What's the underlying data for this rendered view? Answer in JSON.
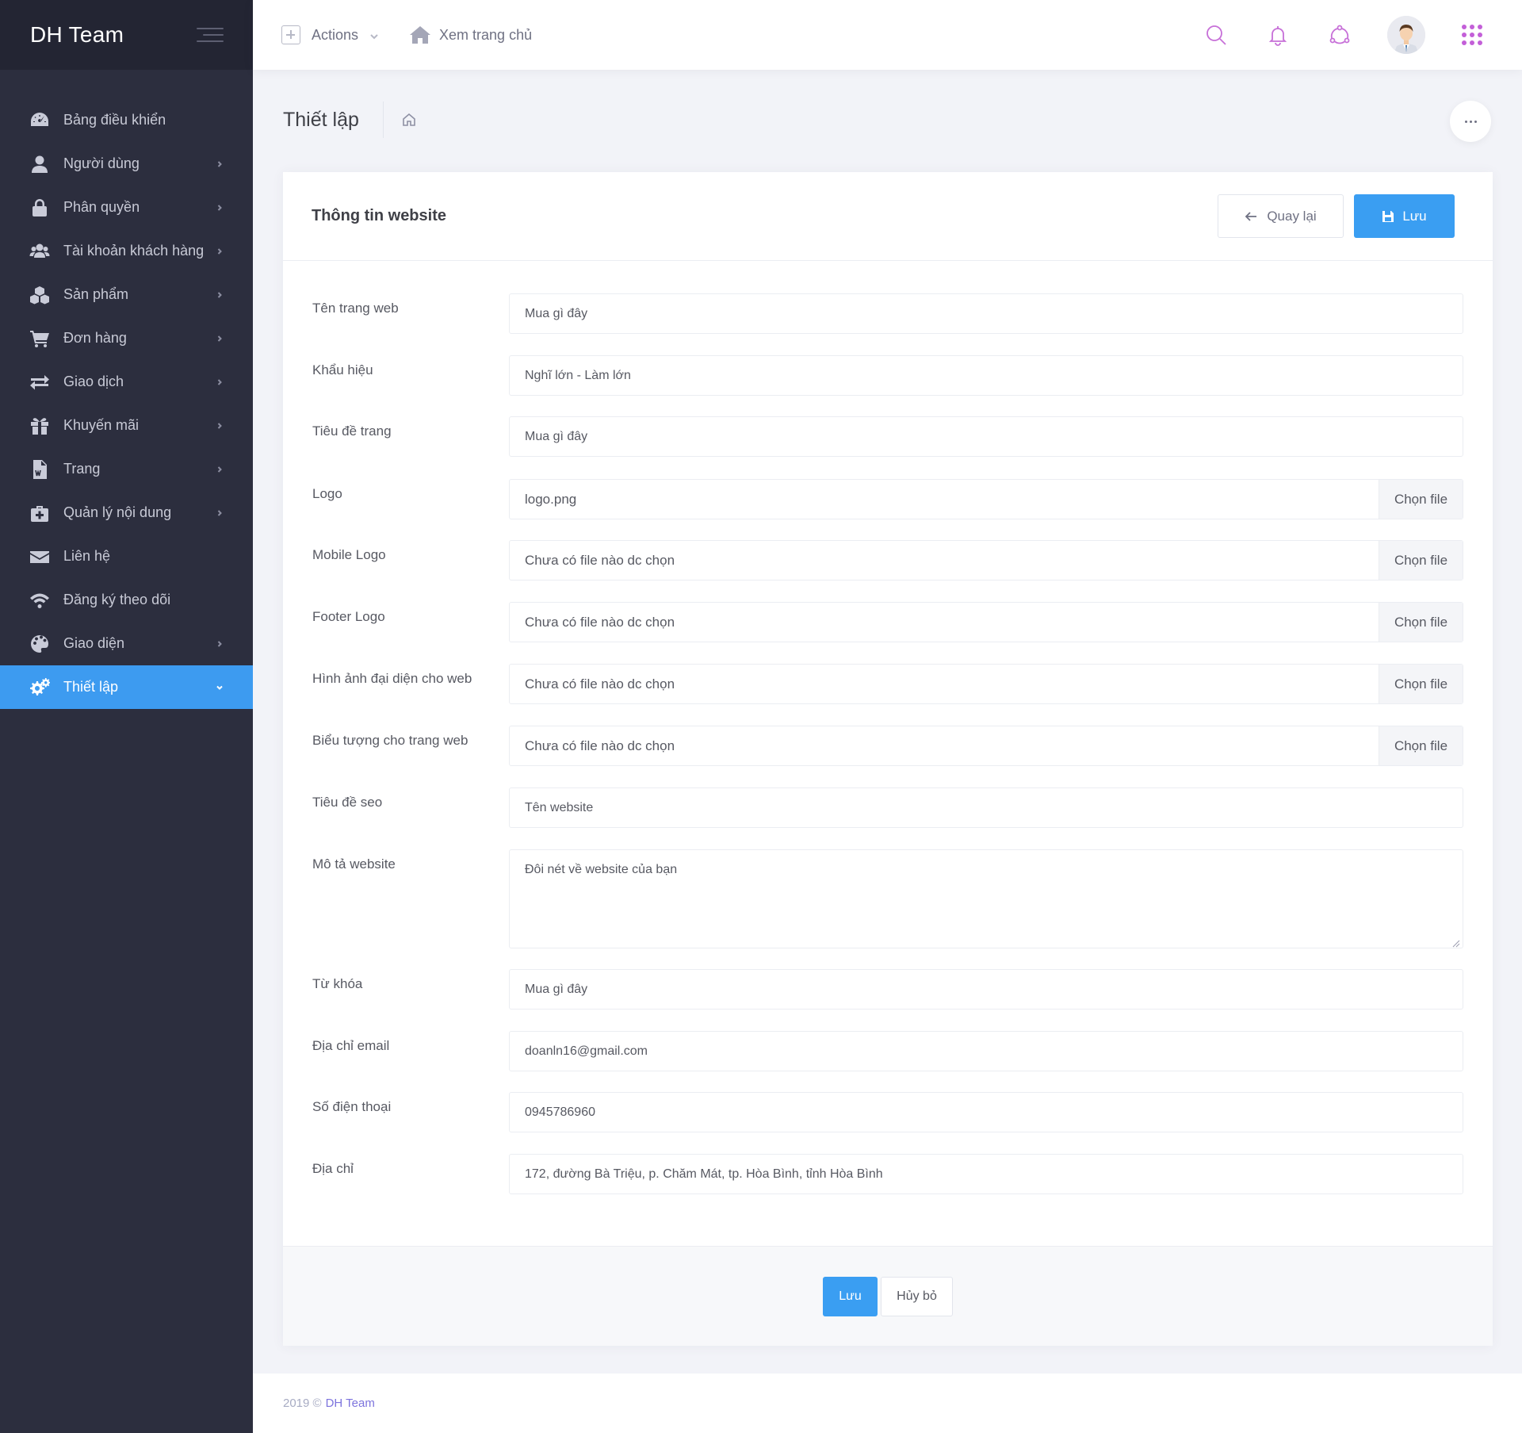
{
  "brand": {
    "name": "DH Team"
  },
  "sidebar": {
    "items": [
      {
        "label": "Bảng điều khiển",
        "icon": "dashboard-icon",
        "has_arrow": false,
        "active": false
      },
      {
        "label": "Người dùng",
        "icon": "user-icon",
        "has_arrow": true,
        "active": false
      },
      {
        "label": "Phân quyền",
        "icon": "lock-icon",
        "has_arrow": true,
        "active": false
      },
      {
        "label": "Tài khoản khách hàng",
        "icon": "users-icon",
        "has_arrow": true,
        "active": false
      },
      {
        "label": "Sản phẩm",
        "icon": "cubes-icon",
        "has_arrow": true,
        "active": false
      },
      {
        "label": "Đơn hàng",
        "icon": "cart-icon",
        "has_arrow": true,
        "active": false
      },
      {
        "label": "Giao dịch",
        "icon": "exchange-icon",
        "has_arrow": true,
        "active": false
      },
      {
        "label": "Khuyến mãi",
        "icon": "gift-icon",
        "has_arrow": true,
        "active": false
      },
      {
        "label": "Trang",
        "icon": "file-word-icon",
        "has_arrow": true,
        "active": false
      },
      {
        "label": "Quản lý nội dung",
        "icon": "medkit-icon",
        "has_arrow": true,
        "active": false
      },
      {
        "label": "Liên hệ",
        "icon": "envelope-icon",
        "has_arrow": false,
        "active": false
      },
      {
        "label": "Đăng ký theo dõi",
        "icon": "wifi-icon",
        "has_arrow": false,
        "active": false
      },
      {
        "label": "Giao diện",
        "icon": "palette-icon",
        "has_arrow": true,
        "active": false
      },
      {
        "label": "Thiết lập",
        "icon": "cogs-icon",
        "has_arrow": true,
        "active": true
      }
    ]
  },
  "header": {
    "actions_label": "Actions",
    "home_label": "Xem trang chủ",
    "icons": [
      "search-icon",
      "bell-icon",
      "share-icon",
      "avatar",
      "apps-icon"
    ],
    "accent_color": "#c770d8"
  },
  "subheader": {
    "title": "Thiết lập"
  },
  "portlet": {
    "title": "Thông tin website",
    "back_label": "Quay lại",
    "save_label": "Lưu"
  },
  "form": {
    "fields": [
      {
        "label": "Tên trang web",
        "type": "text",
        "value": "Mua gì đây"
      },
      {
        "label": "Khẩu hiệu",
        "type": "text",
        "value": "Nghĩ lớn - Làm lớn"
      },
      {
        "label": "Tiêu đề trang",
        "type": "text",
        "value": "Mua gì đây"
      },
      {
        "label": "Logo",
        "type": "file",
        "value": "logo.png",
        "button": "Chọn file"
      },
      {
        "label": "Mobile Logo",
        "type": "file",
        "value": "Chưa có file nào dc chọn",
        "button": "Chọn file"
      },
      {
        "label": "Footer Logo",
        "type": "file",
        "value": "Chưa có file nào dc chọn",
        "button": "Chọn file"
      },
      {
        "label": "Hình ảnh đại diện cho web",
        "type": "file",
        "value": "Chưa có file nào dc chọn",
        "button": "Chọn file"
      },
      {
        "label": "Biểu tượng cho trang web",
        "type": "file",
        "value": "Chưa có file nào dc chọn",
        "button": "Chọn file"
      },
      {
        "label": "Tiêu đề seo",
        "type": "text",
        "value": "Tên website"
      },
      {
        "label": "Mô tả website",
        "type": "textarea",
        "value": "Đôi nét về website của bạn"
      },
      {
        "label": "Từ khóa",
        "type": "text",
        "value": "Mua gì đây"
      },
      {
        "label": "Địa chỉ email",
        "type": "text",
        "value": "doanln16@gmail.com"
      },
      {
        "label": "Số điện thoại",
        "type": "text",
        "value": "0945786960"
      },
      {
        "label": "Địa chỉ",
        "type": "text",
        "value": "172, đường Bà Triệu, p. Chăm Mát, tp. Hòa Bình, tỉnh Hòa Bình"
      }
    ]
  },
  "form_footer": {
    "save_label": "Lưu",
    "cancel_label": "Hủy bỏ"
  },
  "footer": {
    "copyright": "2019 ©",
    "brand": "DH Team"
  },
  "colors": {
    "sidebar_bg": "#2c2e3e",
    "active_item": "#3d9bf0",
    "primary_button": "#3a9ef2"
  }
}
